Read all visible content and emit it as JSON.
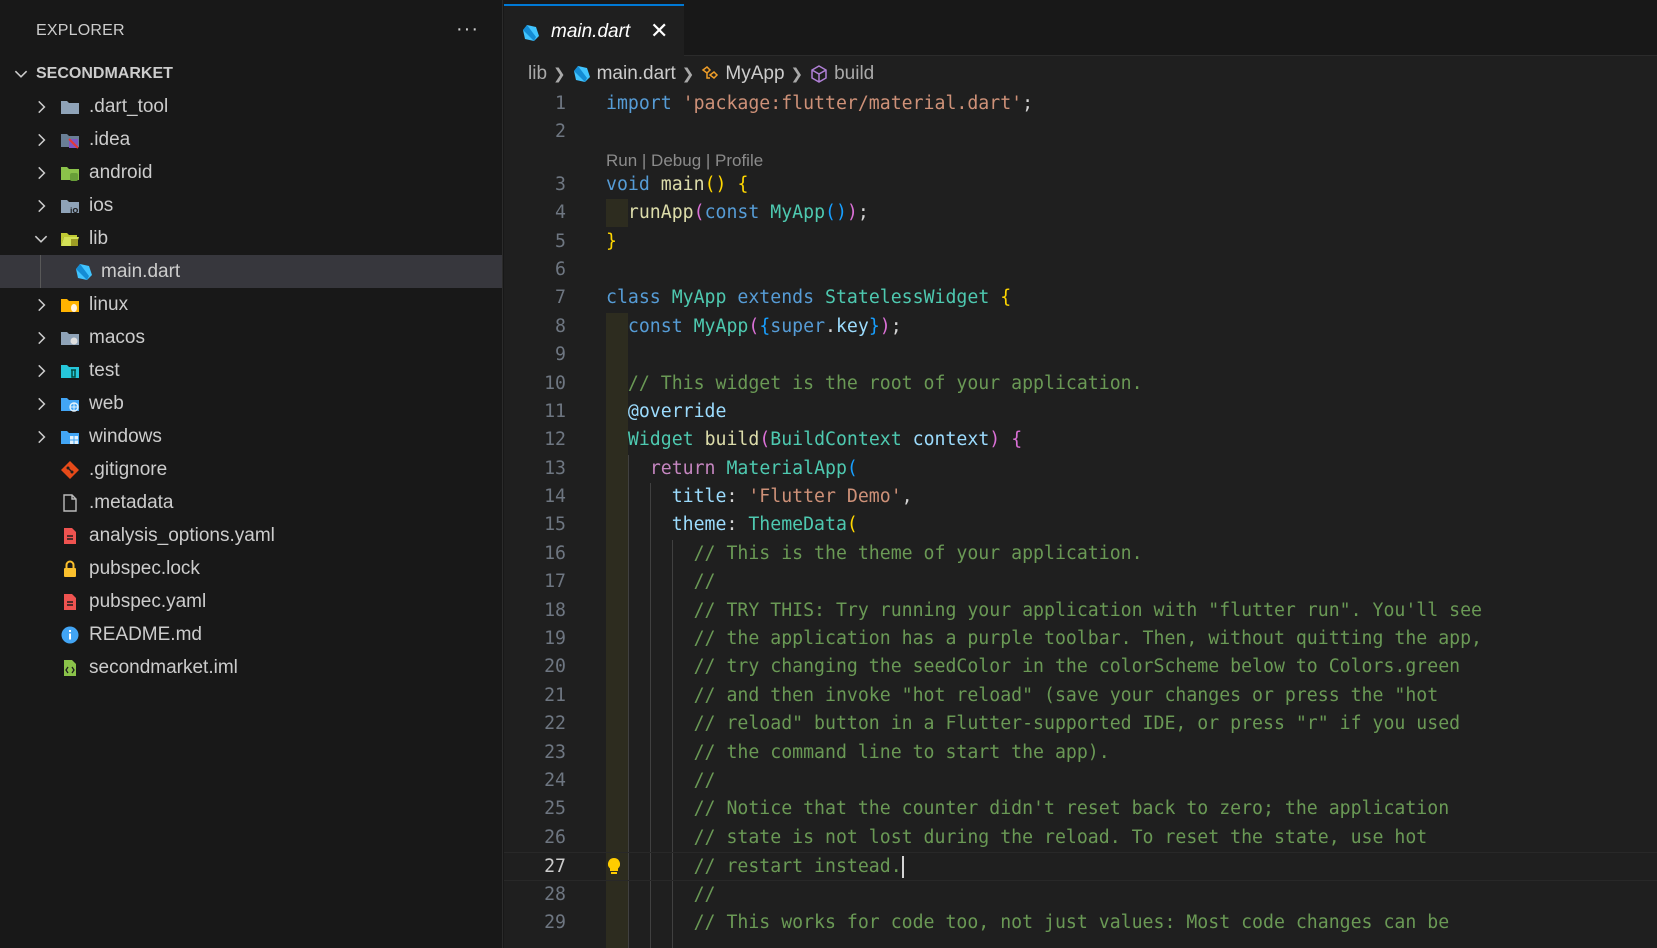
{
  "sidebar": {
    "title": "EXPLORER",
    "more": "···",
    "project": "SECONDMARKET",
    "items": [
      {
        "label": ".dart_tool",
        "type": "folder",
        "expanded": false,
        "icon": "folder-icon",
        "color": "#8fa3b8"
      },
      {
        "label": ".idea",
        "type": "folder",
        "expanded": false,
        "icon": "idea-folder-icon",
        "color": "#7e57c2"
      },
      {
        "label": "android",
        "type": "folder",
        "expanded": false,
        "icon": "android-folder-icon",
        "color": "#8bc34a"
      },
      {
        "label": "ios",
        "type": "folder",
        "expanded": false,
        "icon": "ios-folder-icon",
        "color": "#8fa3b8"
      },
      {
        "label": "lib",
        "type": "folder",
        "expanded": true,
        "icon": "lib-folder-open-icon",
        "color": "#c0ca33"
      },
      {
        "label": "main.dart",
        "type": "file",
        "selected": true,
        "icon": "dart-icon",
        "color": "#40c4ff"
      },
      {
        "label": "linux",
        "type": "folder",
        "expanded": false,
        "icon": "linux-folder-icon",
        "color": "#ffb300"
      },
      {
        "label": "macos",
        "type": "folder",
        "expanded": false,
        "icon": "macos-folder-icon",
        "color": "#8fa3b8"
      },
      {
        "label": "test",
        "type": "folder",
        "expanded": false,
        "icon": "test-folder-icon",
        "color": "#26c6da"
      },
      {
        "label": "web",
        "type": "folder",
        "expanded": false,
        "icon": "web-folder-icon",
        "color": "#42a5f5"
      },
      {
        "label": "windows",
        "type": "folder",
        "expanded": false,
        "icon": "windows-folder-icon",
        "color": "#42a5f5"
      },
      {
        "label": ".gitignore",
        "type": "file",
        "icon": "git-icon",
        "color": "#e64a19"
      },
      {
        "label": ".metadata",
        "type": "file",
        "icon": "file-icon",
        "color": "#bbbbbb"
      },
      {
        "label": "analysis_options.yaml",
        "type": "file",
        "icon": "yaml-icon",
        "color": "#ef5350"
      },
      {
        "label": "pubspec.lock",
        "type": "file",
        "icon": "lock-icon",
        "color": "#fbc02d"
      },
      {
        "label": "pubspec.yaml",
        "type": "file",
        "icon": "yaml-icon",
        "color": "#ef5350"
      },
      {
        "label": "README.md",
        "type": "file",
        "icon": "info-icon",
        "color": "#42a5f5"
      },
      {
        "label": "secondmarket.iml",
        "type": "file",
        "icon": "iml-icon",
        "color": "#8bc34a"
      }
    ]
  },
  "editor": {
    "tab": {
      "label": "main.dart",
      "close": "✕"
    },
    "breadcrumbs": {
      "folder": "lib",
      "file": "main.dart",
      "class": "MyApp",
      "method": "build"
    },
    "codelens": "Run | Debug | Profile",
    "active_line": 27,
    "lines": [
      {
        "n": "1",
        "tokens": [
          [
            "kw",
            "import"
          ],
          [
            "plain",
            " "
          ],
          [
            "str",
            "'package:flutter/material.dart'"
          ],
          [
            "plain",
            ";"
          ]
        ]
      },
      {
        "n": "2",
        "tokens": []
      },
      {
        "n": "3",
        "tokens": [
          [
            "kw",
            "void"
          ],
          [
            "plain",
            " "
          ],
          [
            "fn",
            "main"
          ],
          [
            "p1",
            "()"
          ],
          [
            "plain",
            " "
          ],
          [
            "p1",
            "{"
          ]
        ]
      },
      {
        "n": "4",
        "tokens": [
          [
            "plain",
            "  "
          ],
          [
            "fn",
            "runApp"
          ],
          [
            "p2",
            "("
          ],
          [
            "kw",
            "const"
          ],
          [
            "plain",
            " "
          ],
          [
            "cls",
            "MyApp"
          ],
          [
            "p3",
            "()"
          ],
          [
            "p2",
            ")"
          ],
          [
            "plain",
            ";"
          ]
        ]
      },
      {
        "n": "5",
        "tokens": [
          [
            "p1",
            "}"
          ]
        ]
      },
      {
        "n": "6",
        "tokens": []
      },
      {
        "n": "7",
        "tokens": [
          [
            "kw",
            "class"
          ],
          [
            "plain",
            " "
          ],
          [
            "cls",
            "MyApp"
          ],
          [
            "plain",
            " "
          ],
          [
            "kw",
            "extends"
          ],
          [
            "plain",
            " "
          ],
          [
            "cls",
            "StatelessWidget"
          ],
          [
            "plain",
            " "
          ],
          [
            "p1",
            "{"
          ]
        ]
      },
      {
        "n": "8",
        "tokens": [
          [
            "plain",
            "  "
          ],
          [
            "kw",
            "const"
          ],
          [
            "plain",
            " "
          ],
          [
            "cls",
            "MyApp"
          ],
          [
            "p2",
            "("
          ],
          [
            "p3",
            "{"
          ],
          [
            "kw",
            "super"
          ],
          [
            "plain",
            "."
          ],
          [
            "var",
            "key"
          ],
          [
            "p3",
            "}"
          ],
          [
            "p2",
            ")"
          ],
          [
            "plain",
            ";"
          ]
        ]
      },
      {
        "n": "9",
        "tokens": []
      },
      {
        "n": "10",
        "tokens": [
          [
            "plain",
            "  "
          ],
          [
            "cmt",
            "// This widget is the root of your application."
          ]
        ]
      },
      {
        "n": "11",
        "tokens": [
          [
            "plain",
            "  "
          ],
          [
            "var",
            "@override"
          ]
        ]
      },
      {
        "n": "12",
        "tokens": [
          [
            "plain",
            "  "
          ],
          [
            "cls",
            "Widget"
          ],
          [
            "plain",
            " "
          ],
          [
            "fn",
            "build"
          ],
          [
            "p2",
            "("
          ],
          [
            "cls",
            "BuildContext"
          ],
          [
            "plain",
            " "
          ],
          [
            "var",
            "context"
          ],
          [
            "p2",
            ")"
          ],
          [
            "plain",
            " "
          ],
          [
            "p2",
            "{"
          ]
        ]
      },
      {
        "n": "13",
        "tokens": [
          [
            "plain",
            "    "
          ],
          [
            "kw2",
            "return"
          ],
          [
            "plain",
            " "
          ],
          [
            "cls",
            "MaterialApp"
          ],
          [
            "p3",
            "("
          ]
        ]
      },
      {
        "n": "14",
        "tokens": [
          [
            "plain",
            "      "
          ],
          [
            "var",
            "title"
          ],
          [
            "plain",
            ": "
          ],
          [
            "str",
            "'Flutter Demo'"
          ],
          [
            "plain",
            ","
          ]
        ]
      },
      {
        "n": "15",
        "tokens": [
          [
            "plain",
            "      "
          ],
          [
            "var",
            "theme"
          ],
          [
            "plain",
            ": "
          ],
          [
            "cls",
            "ThemeData"
          ],
          [
            "p1",
            "("
          ]
        ]
      },
      {
        "n": "16",
        "tokens": [
          [
            "plain",
            "        "
          ],
          [
            "cmt",
            "// This is the theme of your application."
          ]
        ]
      },
      {
        "n": "17",
        "tokens": [
          [
            "plain",
            "        "
          ],
          [
            "cmt",
            "//"
          ]
        ]
      },
      {
        "n": "18",
        "tokens": [
          [
            "plain",
            "        "
          ],
          [
            "cmt",
            "// TRY THIS: Try running your application with \"flutter run\". You'll see"
          ]
        ]
      },
      {
        "n": "19",
        "tokens": [
          [
            "plain",
            "        "
          ],
          [
            "cmt",
            "// the application has a purple toolbar. Then, without quitting the app,"
          ]
        ]
      },
      {
        "n": "20",
        "tokens": [
          [
            "plain",
            "        "
          ],
          [
            "cmt",
            "// try changing the seedColor in the colorScheme below to Colors.green"
          ]
        ]
      },
      {
        "n": "21",
        "tokens": [
          [
            "plain",
            "        "
          ],
          [
            "cmt",
            "// and then invoke \"hot reload\" (save your changes or press the \"hot"
          ]
        ]
      },
      {
        "n": "22",
        "tokens": [
          [
            "plain",
            "        "
          ],
          [
            "cmt",
            "// reload\" button in a Flutter-supported IDE, or press \"r\" if you used"
          ]
        ]
      },
      {
        "n": "23",
        "tokens": [
          [
            "plain",
            "        "
          ],
          [
            "cmt",
            "// the command line to start the app)."
          ]
        ]
      },
      {
        "n": "24",
        "tokens": [
          [
            "plain",
            "        "
          ],
          [
            "cmt",
            "//"
          ]
        ]
      },
      {
        "n": "25",
        "tokens": [
          [
            "plain",
            "        "
          ],
          [
            "cmt",
            "// Notice that the counter didn't reset back to zero; the application"
          ]
        ]
      },
      {
        "n": "26",
        "tokens": [
          [
            "plain",
            "        "
          ],
          [
            "cmt",
            "// state is not lost during the reload. To reset the state, use hot"
          ]
        ]
      },
      {
        "n": "27",
        "tokens": [
          [
            "plain",
            "        "
          ],
          [
            "cmt",
            "// restart instead."
          ]
        ]
      },
      {
        "n": "28",
        "tokens": [
          [
            "plain",
            "        "
          ],
          [
            "cmt",
            "//"
          ]
        ]
      },
      {
        "n": "29",
        "tokens": [
          [
            "plain",
            "        "
          ],
          [
            "cmt",
            "// This works for code too, not just values: Most code changes can be"
          ]
        ]
      }
    ]
  }
}
